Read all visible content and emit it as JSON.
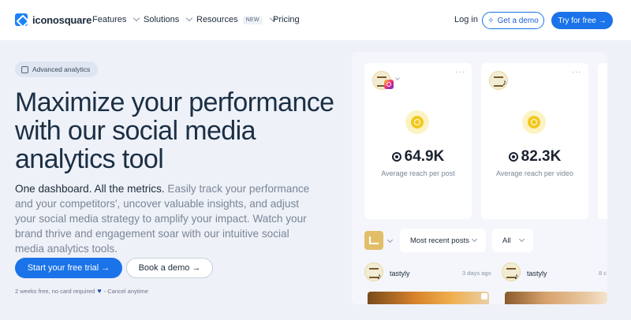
{
  "nav": {
    "logo": "iconosquare",
    "features": "Features",
    "solutions": "Solutions",
    "resources": "Resources",
    "new_badge": "NEW",
    "pricing": "Pricing",
    "login": "Log in",
    "get_demo": "Get a demo",
    "try_free": "Try for free →"
  },
  "hero": {
    "badge": "Advanced analytics",
    "title": "Maximize your performance with our social media analytics tool",
    "desc_strong": "One dashboard. All the metrics.",
    "desc_rest": " Easily track your performance and your competitors', uncover valuable insights, and adjust your social media strategy to amplify your impact. Watch your brand thrive and engagement soar with our intuitive social media analytics tools.",
    "cta_trial": "Start your free trial →",
    "cta_book": "Book a demo →",
    "note_pre": "2 weeks free, no card required",
    "note_post": "- Cancel anytime"
  },
  "cards": [
    {
      "value": "64.9K",
      "label": "Average reach per post",
      "network": "instagram"
    },
    {
      "value": "82.3K",
      "label": "Average reach per video",
      "network": "tiktok"
    }
  ],
  "filters": {
    "sort": "Most recent posts",
    "scope": "All"
  },
  "posts": [
    {
      "name": "tastyly",
      "time": "3 days ago"
    },
    {
      "name": "tastyly",
      "time": "8 c"
    }
  ],
  "colors": {
    "accent": "#1a73e8",
    "page_bg": "#eef1f8",
    "title": "#1b2f44"
  }
}
